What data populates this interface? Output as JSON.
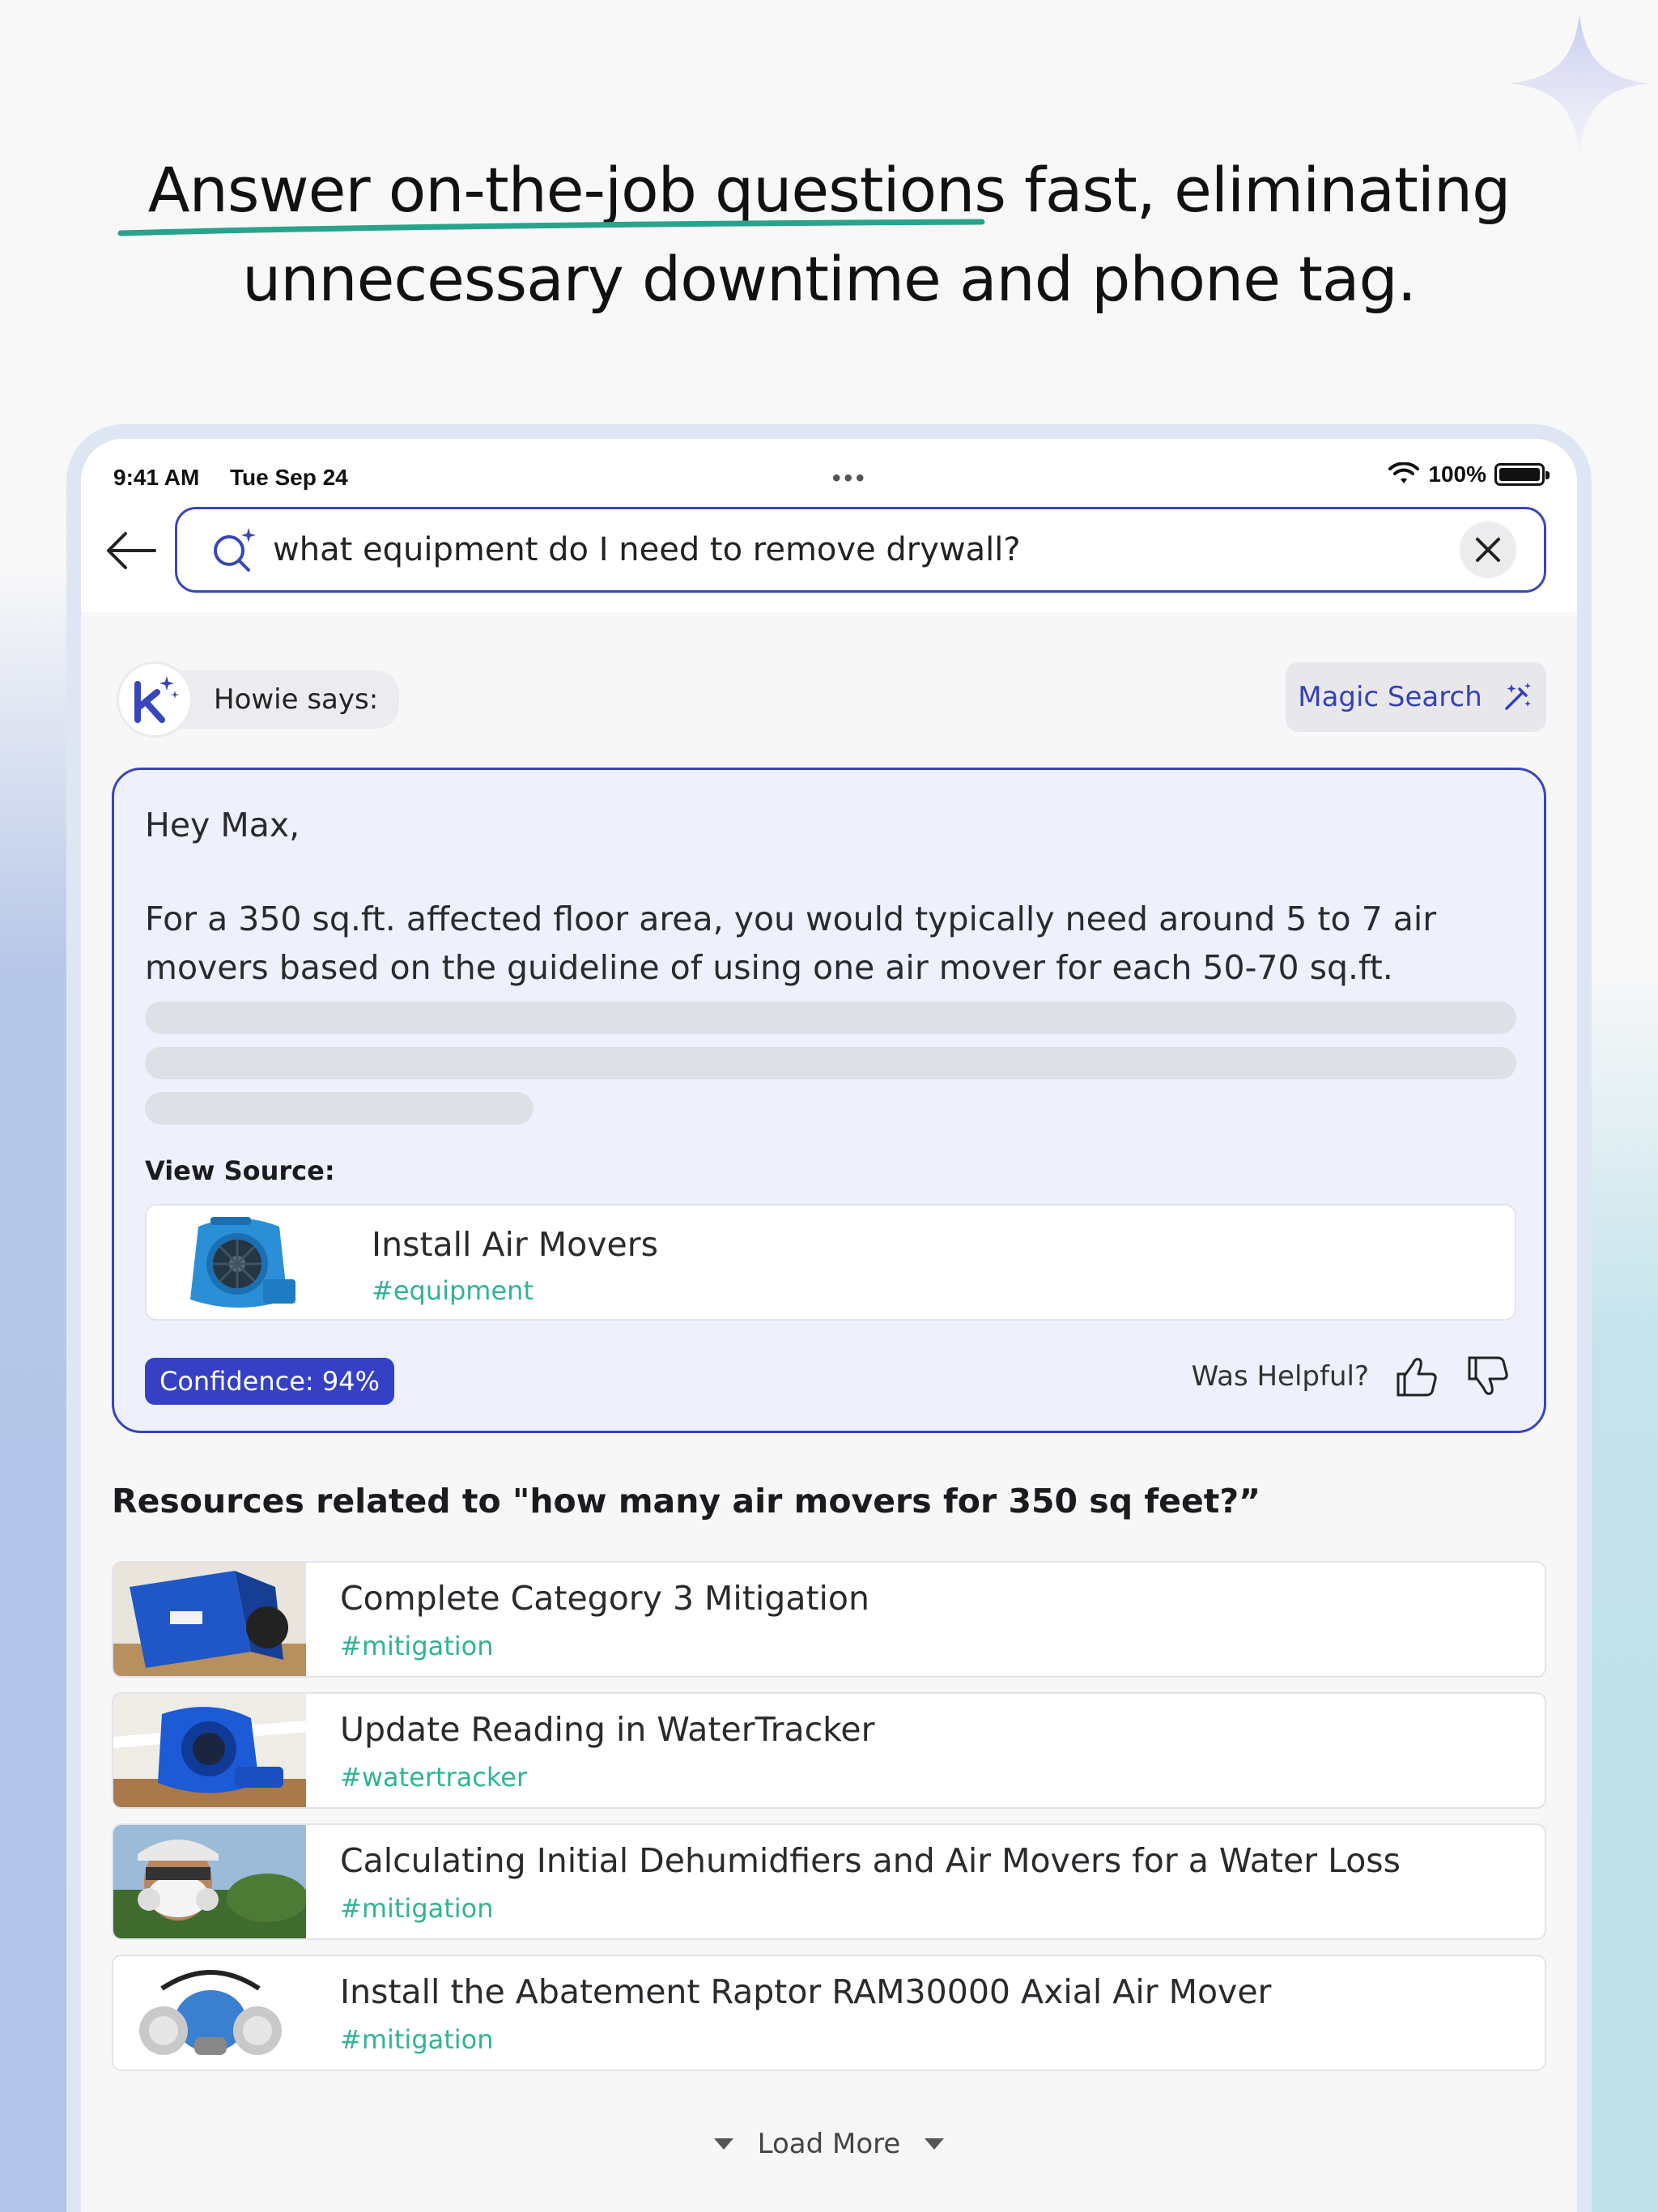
{
  "headline": {
    "line1_underlined": "Answer on-the-job questions",
    "line1_rest": " fast, eliminating",
    "line2": "unnecessary downtime and phone tag."
  },
  "status_bar": {
    "time": "9:41 AM",
    "date": "Tue Sep 24",
    "battery": "100%"
  },
  "search": {
    "query": "what equipment do I need to remove drywall?"
  },
  "assistant": {
    "says_label": "Howie says:",
    "magic_search_label": "Magic Search"
  },
  "answer": {
    "greeting": "Hey Max,",
    "body_line1": "For a 350 sq.ft. affected floor area, you would typically need around 5 to 7 air",
    "body_line2": "movers based on the guideline of using one air mover for each 50-70 sq.ft.",
    "view_source_label": "View Source:",
    "source": {
      "title": "Install Air Movers",
      "tag": "#equipment"
    },
    "confidence": "Confidence: 94%",
    "helpful_label": "Was Helpful?"
  },
  "related": {
    "title": "Resources related to \"how many air movers for 350 sq feet?”",
    "items": [
      {
        "title": "Complete Category 3 Mitigation",
        "tag": "#mitigation",
        "thumb": "blue-dehumidifier"
      },
      {
        "title": "Update Reading in WaterTracker",
        "tag": "#watertracker",
        "thumb": "blue-air-mover"
      },
      {
        "title": "Calculating Initial Dehumidfiers and Air Movers for a Water Loss",
        "tag": "#mitigation",
        "thumb": "worker-respirator"
      },
      {
        "title": "Install the Abatement Raptor RAM30000 Axial Air Mover",
        "tag": "#mitigation",
        "thumb": "respirator-mask"
      }
    ]
  },
  "load_more_label": "Load More",
  "colors": {
    "accent": "#3846b8",
    "tag_green": "#2fb494",
    "answer_bg": "#eef1fb",
    "underline_teal": "#2aa38c"
  }
}
